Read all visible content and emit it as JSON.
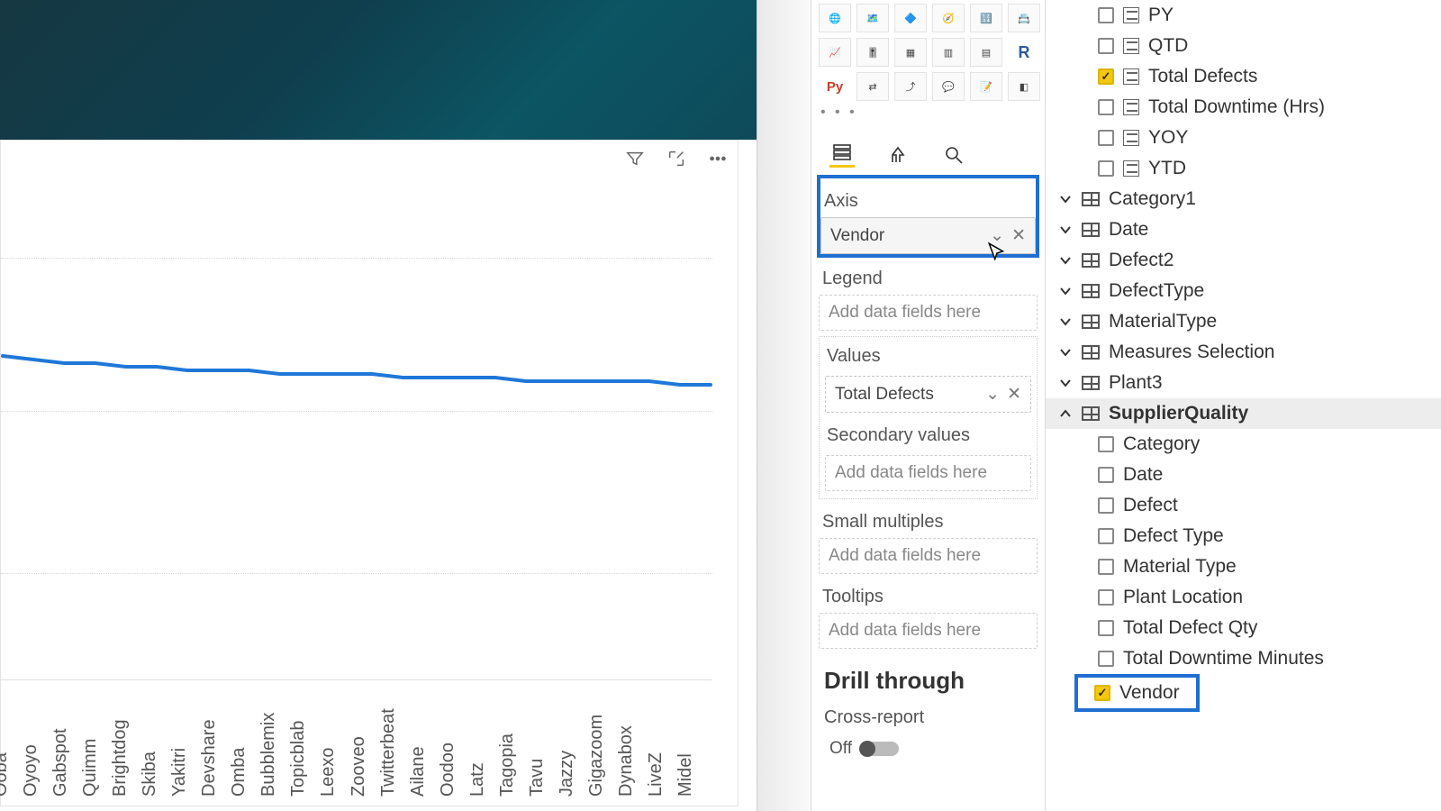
{
  "colors": {
    "accent_blue": "#1f6fd1",
    "pbi_yellow": "#f2c811",
    "line": "#1f77d8"
  },
  "chart_data": {
    "type": "line",
    "title": "",
    "xlabel": "",
    "ylabel": "",
    "ylim": [
      0,
      100
    ],
    "categories": [
      "Ooba",
      "Oyoyo",
      "Gabspot",
      "Quimm",
      "Brightdog",
      "Skiba",
      "Yakitri",
      "Devshare",
      "Omba",
      "Bubblemix",
      "Topicblab",
      "Leexo",
      "Zooveo",
      "Twitterbeat",
      "Ailane",
      "Oodoo",
      "Latz",
      "Tagopia",
      "Tavu",
      "Jazzy",
      "Gigazoom",
      "Dynabox",
      "LiveZ",
      "Midel"
    ],
    "values": [
      70,
      69,
      68,
      68,
      67,
      67,
      66,
      66,
      66,
      65,
      65,
      65,
      65,
      64,
      64,
      64,
      64,
      63,
      63,
      63,
      63,
      63,
      62,
      62
    ]
  },
  "wells": {
    "axis_label": "Axis",
    "axis_value": "Vendor",
    "legend_label": "Legend",
    "legend_placeholder": "Add data fields here",
    "values_label": "Values",
    "values_value": "Total Defects",
    "secondary_label": "Secondary values",
    "secondary_placeholder": "Add data fields here",
    "smallmult_label": "Small multiples",
    "smallmult_placeholder": "Add data fields here",
    "tooltips_label": "Tooltips",
    "tooltips_placeholder": "Add data fields here",
    "drill_label": "Drill through",
    "cross_label": "Cross-report",
    "cross_state": "Off"
  },
  "viz_more": "• • •",
  "fields": {
    "top_measures": [
      {
        "label": "PY",
        "checked": false
      },
      {
        "label": "QTD",
        "checked": false
      },
      {
        "label": "Total Defects",
        "checked": true
      },
      {
        "label": "Total Downtime (Hrs)",
        "checked": false
      },
      {
        "label": "YOY",
        "checked": false
      },
      {
        "label": "YTD",
        "checked": false
      }
    ],
    "tables": [
      {
        "label": "Category1"
      },
      {
        "label": "Date"
      },
      {
        "label": "Defect2"
      },
      {
        "label": "DefectType"
      },
      {
        "label": "MaterialType"
      },
      {
        "label": "Measures Selection"
      },
      {
        "label": "Plant3"
      }
    ],
    "sq_label": "SupplierQuality",
    "sq_fields": [
      {
        "label": "Category",
        "checked": false
      },
      {
        "label": "Date",
        "checked": false
      },
      {
        "label": "Defect",
        "checked": false
      },
      {
        "label": "Defect Type",
        "checked": false
      },
      {
        "label": "Material Type",
        "checked": false
      },
      {
        "label": "Plant Location",
        "checked": false
      },
      {
        "label": "Total Defect Qty",
        "checked": false
      },
      {
        "label": "Total Downtime Minutes",
        "checked": false
      },
      {
        "label": "Vendor",
        "checked": true,
        "highlight": true
      }
    ]
  }
}
